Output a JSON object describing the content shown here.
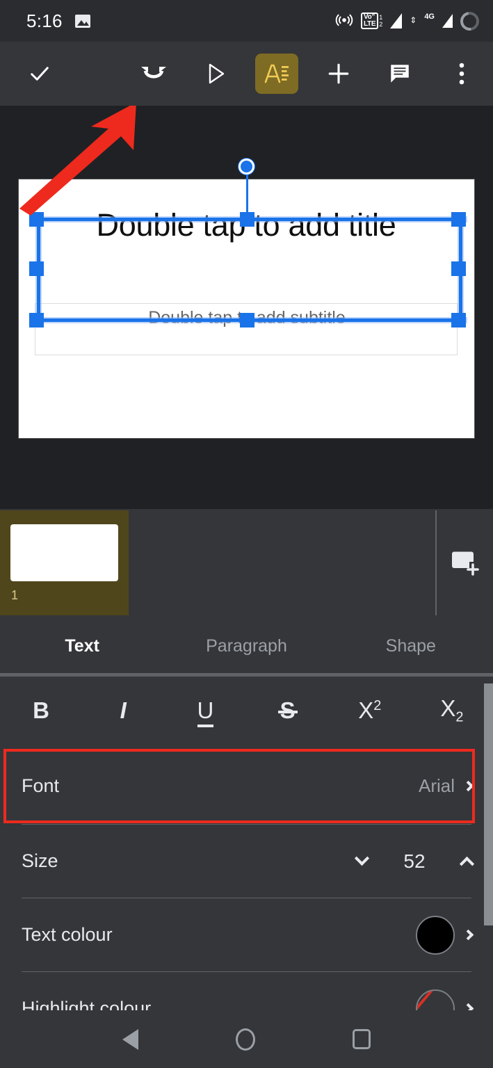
{
  "statusbar": {
    "time": "5:16",
    "left_icons": [
      "image-icon"
    ],
    "right_icons": [
      "hotspot-icon",
      "volte-dual-sim-icon",
      "signal-bars-icon",
      "4g-data-icon",
      "battery-ring-icon"
    ],
    "volte": {
      "line1": "Vo’’",
      "line2": "LTE",
      "sim1": "1",
      "sim2": "2"
    },
    "network_label": "4G"
  },
  "toolbar": {
    "done_label": "check-icon",
    "undo_label": "undo-redo-icon",
    "present_label": "play-icon",
    "format_label": "format-text-icon",
    "add_label": "add-icon",
    "comment_label": "comment-icon",
    "more_label": "more-options-icon",
    "active_tool": "format-text-icon",
    "accent_color": "#7e6c24",
    "accent_icon_color": "#f2cb55"
  },
  "canvas": {
    "slide_title": "Double tap to add title",
    "slide_subtitle": "Double tap to add subtitle",
    "selection_color": "#1a73e8",
    "annotation_arrow_color": "#ee2a1e"
  },
  "filmstrip": {
    "slides": [
      {
        "number": "1",
        "selected": true
      }
    ],
    "add_slide_label": "add-slide-icon",
    "selected_bg": "#4f461c"
  },
  "tabs": {
    "items": [
      {
        "label": "Text",
        "active": true
      },
      {
        "label": "Paragraph",
        "active": false
      },
      {
        "label": "Shape",
        "active": false
      }
    ],
    "indicator_color": "#f2cb55"
  },
  "panel": {
    "format_buttons": [
      {
        "name": "bold",
        "glyph": "B"
      },
      {
        "name": "italic",
        "glyph": "I"
      },
      {
        "name": "underline",
        "glyph": "U"
      },
      {
        "name": "strikethrough",
        "glyph": "S"
      },
      {
        "name": "superscript",
        "glyph": "X",
        "script": "2"
      },
      {
        "name": "subscript",
        "glyph": "X",
        "script": "2"
      }
    ],
    "rows": {
      "font": {
        "label": "Font",
        "value": "Arial"
      },
      "size": {
        "label": "Size",
        "value": "52"
      },
      "text_colour": {
        "label": "Text colour",
        "swatch": "#000000"
      },
      "highlight_colour": {
        "label": "Highlight colour",
        "swatch": "none"
      }
    },
    "highlighted_row": "font",
    "highlight_border_color": "#ee2a1e"
  },
  "navbar": {
    "back_label": "back-icon",
    "home_label": "home-icon",
    "recents_label": "recents-icon"
  }
}
